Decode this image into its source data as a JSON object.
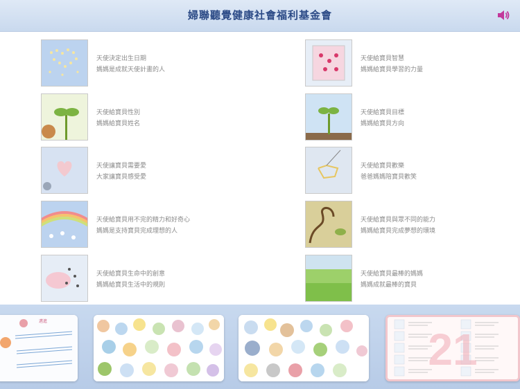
{
  "header": {
    "title": "婦聯聽覺健康社會福利基金會",
    "speaker_icon": "speaker-icon"
  },
  "items": [
    {
      "line1": "天使決定出生日期",
      "line2": "媽媽是成就天使計畫的人"
    },
    {
      "line1": "天使給寶貝智慧",
      "line2": "媽媽給寶貝學習的力量"
    },
    {
      "line1": "天使給寶貝性別",
      "line2": "媽媽給寶貝姓名"
    },
    {
      "line1": "天使給寶貝目標",
      "line2": "媽媽給寶貝方向"
    },
    {
      "line1": "天使讓寶貝需要愛",
      "line2": "大家讓寶貝感受愛"
    },
    {
      "line1": "天使給寶貝歡樂",
      "line2": "爸爸媽媽陪寶貝歡笑"
    },
    {
      "line1": "天使給寶貝用不完的精力和好奇心",
      "line2": "媽媽是支持寶貝完成理想的人"
    },
    {
      "line1": "天使給寶貝與眾不同的能力",
      "line2": "媽媽給寶貝完成夢想的環境"
    },
    {
      "line1": "天使給寶貝生命中的創意",
      "line2": "媽媽給寶貝生活中的規則"
    },
    {
      "line1": "天使給寶貝最棒的媽媽",
      "line2": "媽媽成就最棒的寶貝"
    }
  ],
  "pages": {
    "current_page": "21",
    "first_card_label": "邁進"
  }
}
